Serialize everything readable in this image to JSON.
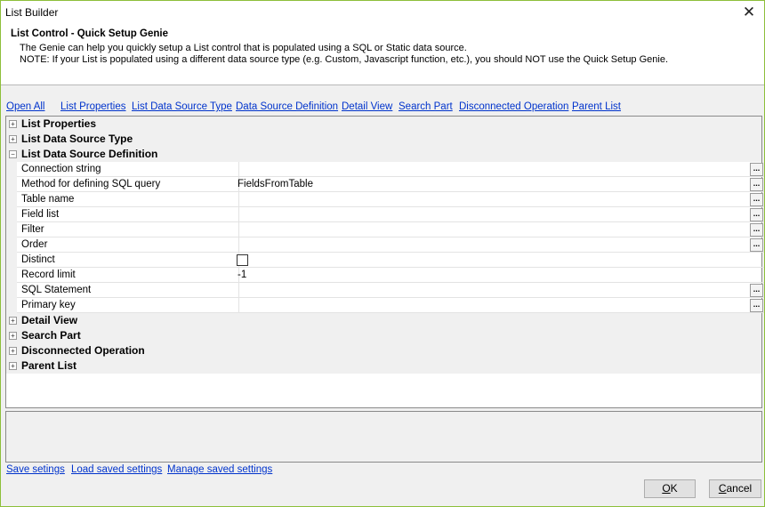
{
  "window": {
    "title": "List Builder",
    "close_glyph": "✕"
  },
  "header": {
    "title": "List Control - Quick Setup Genie",
    "line1": "The Genie can help you quickly setup a List control that is populated using a SQL or Static data source.",
    "line2": "NOTE: If your List is populated using a different data source type (e.g. Custom, Javascript function, etc.), you should NOT use the Quick Setup Genie."
  },
  "nav": {
    "open_all": "Open All",
    "list_properties": "List Properties",
    "list_data_source_type": "List Data Source Type",
    "data_source_definition": "Data Source Definition",
    "detail_view": "Detail View",
    "search_part": "Search Part",
    "disconnected_operation": "Disconnected Operation",
    "parent_list": "Parent List"
  },
  "grid": {
    "expand_glyph": "+",
    "collapse_glyph": "−",
    "ellipsis": "...",
    "categories": {
      "list_properties": "List Properties",
      "list_data_source_type": "List Data Source Type",
      "list_data_source_definition": "List Data Source Definition",
      "detail_view": "Detail View",
      "search_part": "Search Part",
      "disconnected_operation": "Disconnected Operation",
      "parent_list": "Parent List"
    },
    "properties": {
      "connection_string": {
        "name": "Connection string",
        "value": ""
      },
      "method": {
        "name": "Method for defining SQL query",
        "value": "FieldsFromTable"
      },
      "table_name": {
        "name": "Table name",
        "value": ""
      },
      "field_list": {
        "name": "Field list",
        "value": ""
      },
      "filter": {
        "name": "Filter",
        "value": ""
      },
      "order": {
        "name": "Order",
        "value": ""
      },
      "distinct": {
        "name": "Distinct",
        "checked": false
      },
      "record_limit": {
        "name": "Record limit",
        "value": "-1"
      },
      "sql_statement": {
        "name": "SQL Statement",
        "value": ""
      },
      "primary_key": {
        "name": "Primary key",
        "value": ""
      }
    }
  },
  "bottom": {
    "save_settings": "Save setings",
    "load_saved_settings": "Load saved settings",
    "manage_saved_settings": "Manage saved settings"
  },
  "buttons": {
    "ok_mnemonic": "O",
    "ok_rest": "K",
    "cancel_mnemonic": "C",
    "cancel_rest": "ancel"
  }
}
